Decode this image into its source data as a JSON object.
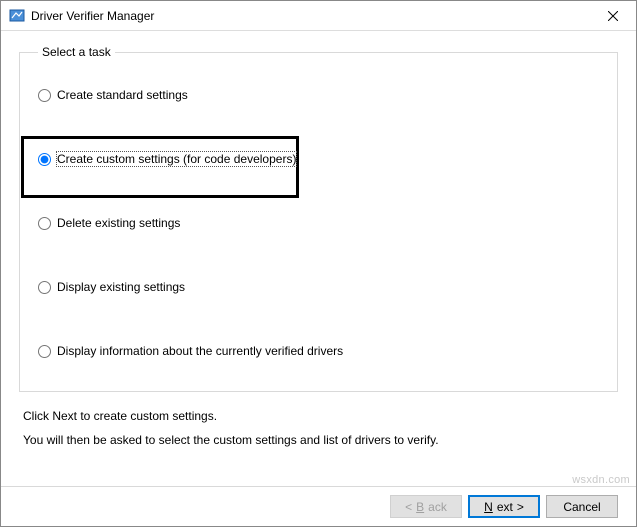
{
  "window": {
    "title": "Driver Verifier Manager"
  },
  "group": {
    "legend": "Select a task",
    "options": {
      "standard": "Create standard settings",
      "custom": "Create custom settings (for code developers)",
      "delete": "Delete existing settings",
      "display": "Display existing settings",
      "info": "Display information about the currently verified drivers"
    },
    "selected": "custom"
  },
  "instructions": {
    "line1": "Click Next to create custom settings.",
    "line2": "You will then be asked to select the custom settings and list of drivers to verify."
  },
  "buttons": {
    "back_prefix": "< ",
    "back_u": "B",
    "back_rest": "ack",
    "next_u": "N",
    "next_rest": "ext",
    "next_suffix": " >",
    "cancel": "Cancel"
  },
  "watermark": "wsxdn.com"
}
